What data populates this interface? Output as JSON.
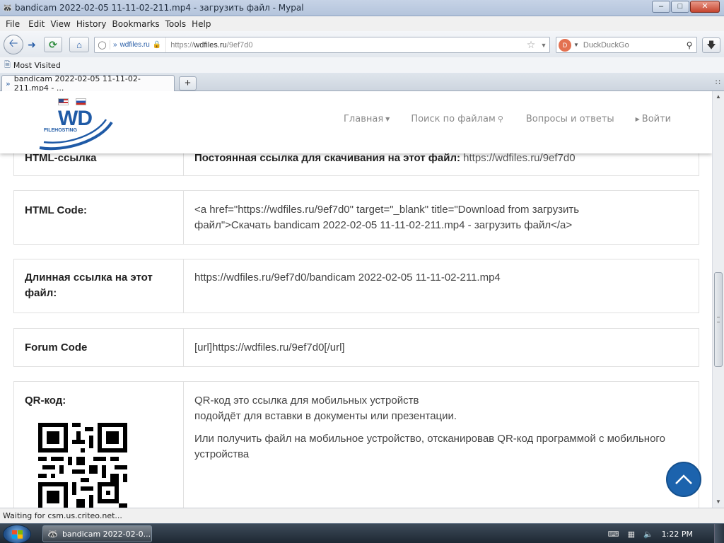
{
  "window": {
    "title": "bandicam 2022-02-05 11-11-02-211.mp4 - загрузить файл - Mypal",
    "minimize": "–",
    "maximize": "□",
    "close": "✕"
  },
  "menu": [
    "File",
    "Edit",
    "View",
    "History",
    "Bookmarks",
    "Tools",
    "Help"
  ],
  "navbar": {
    "site_label": "wdfiles.ru",
    "url_prefix": "https://",
    "url_host": "wdfiles.ru",
    "url_path": "/9ef7d0",
    "search_placeholder": "DuckDuckGo"
  },
  "bookmarks": {
    "most_visited": "Most Visited"
  },
  "tab": {
    "title": "bandicam 2022-02-05 11-11-02-211.mp4 - ..."
  },
  "site": {
    "logo_text": "WD",
    "logo_sub": "FILEHOSTING",
    "nav": {
      "home": "Главная",
      "search": "Поиск по файлам",
      "faq": "Вопросы и ответы",
      "login": "Войти"
    }
  },
  "rows": {
    "html_link": {
      "label": "HTML-ссылка",
      "bold": "Постоянная ссылка для скачивания на этот файл:",
      "link": " https://wdfiles.ru/9ef7d0"
    },
    "html_code": {
      "label": "HTML Code:",
      "value": "<a href=\"https://wdfiles.ru/9ef7d0\" target=\"_blank\" title=\"Download from загрузить файл\">Скачать bandicam 2022-02-05 11-11-02-211.mp4 - загрузить файл</a>"
    },
    "long_link": {
      "label": "Длинная ссылка на этот файл:",
      "value": "https://wdfiles.ru/9ef7d0/bandicam 2022-02-05 11-11-02-211.mp4"
    },
    "forum_code": {
      "label": "Forum Code",
      "value": "[url]https://wdfiles.ru/9ef7d0[/url]"
    },
    "qr": {
      "label": "QR-код:",
      "line1": "QR-код это ссылка для мобильных устройств",
      "line2": "подойдёт для вставки в документы или презентации.",
      "line3": "Или получить файл на мобильное устройство, отсканировав QR-код программой с мобильного устройства"
    }
  },
  "status": {
    "text": "Waiting for csm.us.criteo.net..."
  },
  "taskbar": {
    "task_title": "bandicam 2022-02-0...",
    "clock": "1:22 PM"
  },
  "icons": {
    "back": "back-arrow-icon",
    "forward": "forward-arrow-icon",
    "reload": "reload-icon",
    "home": "home-icon",
    "identity": "site-identity-icon",
    "lock": "lock-icon",
    "bookmark_star": "bookmark-star-icon",
    "search": "search-icon",
    "download": "download-icon",
    "back_to_top": "chevron-up-icon"
  },
  "colors": {
    "brand_blue": "#1f5aa6",
    "to_top": "#1c63ad"
  }
}
